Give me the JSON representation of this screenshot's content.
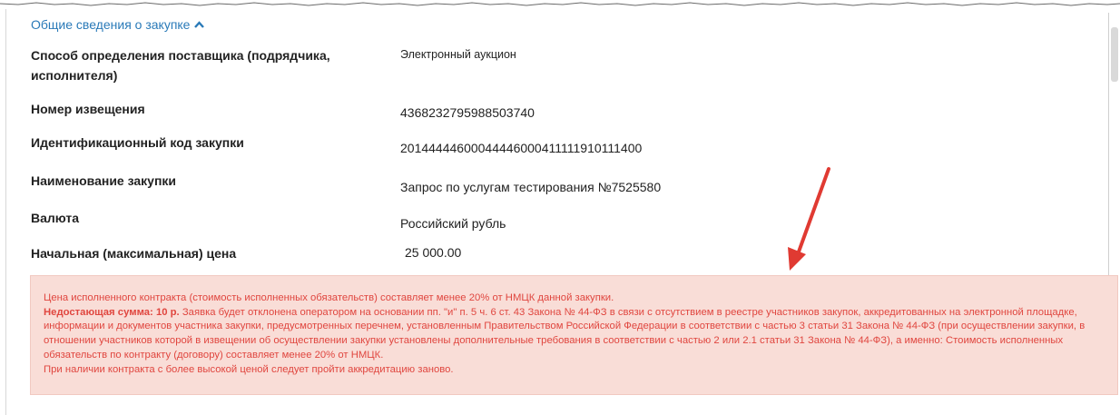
{
  "section": {
    "title": "Общие сведения о закупке",
    "toggle_icon": "chevron-up-icon",
    "accent_color": "#2a7ab8"
  },
  "rows": [
    {
      "label": "Способ определения поставщика (подрядчика, исполнителя)",
      "value": "Электронный аукцион"
    },
    {
      "label": "Номер извещения",
      "value": "4368232795988503740"
    },
    {
      "label": "Идентификационный код закупки",
      "value": "20144444600044446000411111910111400"
    },
    {
      "label": "Наименование закупки",
      "value": "Запрос по услугам тестирования №7525580"
    },
    {
      "label": "Валюта",
      "value": "Российский рубль"
    },
    {
      "label": "Начальная (максимальная) цена",
      "value": "25 000.00"
    }
  ],
  "alert": {
    "line1": "Цена исполненного контракта (стоимость исполненных обязательств) составляет менее 20% от НМЦК данной закупки.",
    "missing_label": "Недостающая сумма: 10 р.",
    "body": "Заявка будет отклонена оператором на основании пп. \"и\" п. 5 ч. 6 ст. 43 Закона № 44-ФЗ в связи с отсутствием в реестре участников закупок, аккредитованных на электронной площадке, информации и документов участника закупки, предусмотренных перечнем, установленным Правительством Российской Федерации в соответствии с частью 3 статьи 31 Закона № 44-ФЗ (при осуществлении закупки, в отношении участников которой в извещении об осуществлении закупки установлены дополнительные требования в соответствии с частью 2 или 2.1 статьи 31 Закона № 44-ФЗ), а именно: Стоимость исполненных обязательств по контракту (договору) составляет менее 20% от НМЦК.",
    "last_line": "При наличии контракта с более высокой ценой следует пройти аккредитацию заново.",
    "text_color": "#e0463f",
    "background_color": "#f9ddd7"
  },
  "annotation": {
    "arrow_icon": "red-arrow-icon",
    "arrow_color": "#e03a32"
  }
}
